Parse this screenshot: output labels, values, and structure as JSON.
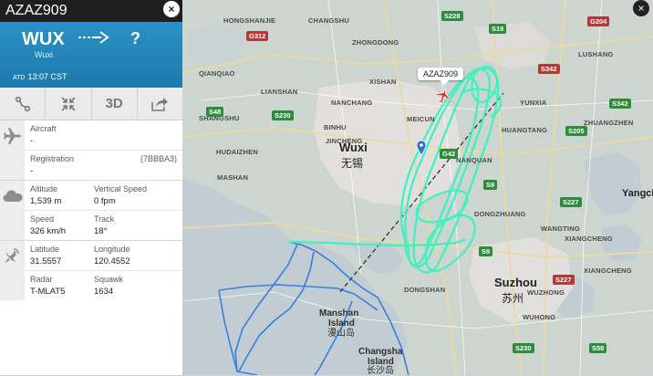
{
  "flight": {
    "callsign": "AZAZ909",
    "origin_code": "WUX",
    "origin_city": "Wuxi",
    "destination_code": "?",
    "atd_label": "ATD",
    "atd_time": "13:07 CST"
  },
  "toolbar": {
    "route_label": "route",
    "fullscreen_label": "fullscreen",
    "view3d_label": "3D",
    "share_label": "share"
  },
  "details": {
    "aircraft_label": "Aircraft",
    "aircraft_value": "-",
    "registration_label": "Registration",
    "registration_value": "-",
    "registration_hex": "(7BBBA3)",
    "altitude_label": "Altitude",
    "altitude_value": "1,539 m",
    "vertical_speed_label": "Vertical Speed",
    "vertical_speed_value": "0 fpm",
    "speed_label": "Speed",
    "speed_value": "326 km/h",
    "track_label": "Track",
    "track_value": "18°",
    "latitude_label": "Latitude",
    "latitude_value": "31.5557",
    "longitude_label": "Longitude",
    "longitude_value": "120.4552",
    "radar_label": "Radar",
    "radar_value": "T-MLAT5",
    "squawk_label": "Squawk",
    "squawk_value": "1634"
  },
  "map": {
    "plane_tag": "AZAZ909",
    "cities": {
      "wuxi": "Wuxi",
      "wuxi_cn": "无锡",
      "suzhou": "Suzhou",
      "suzhou_cn": "苏州",
      "manshan": "Manshan",
      "manshan_2": "Island",
      "manshan_cn": "漫山岛",
      "changsha": "Changsha",
      "changsha_2": "Island",
      "changsha_cn": "长沙岛",
      "yangch": "Yangch"
    },
    "districts": {
      "d1": "HONGSHANJIE",
      "d2": "CHANGSHU",
      "d3": "ZHONGDONG",
      "d4": "XISHAN",
      "d5": "NANCHANG",
      "d6": "LIANSHAN",
      "d7": "SHANGSHU",
      "d8": "YUNXIA",
      "d9": "LUSHANG",
      "d10": "MEICUN",
      "d11": "HUDAIZHEN",
      "d12": "JINCHENG",
      "d13": "BINHU",
      "d14": "NANQUAN",
      "d15": "WANGTING",
      "d16": "XIANGCHENG",
      "d17": "WUZHONG",
      "d18": "WUHONG",
      "d19": "DONGSHAN",
      "d20": "DONGZHUANG",
      "d21": "QIANQIAO",
      "d22": "MASHAN",
      "d23": "HUANGTANG",
      "d24": "ZHUANGZHEN",
      "d25": "XIANGCHENG"
    },
    "roads": {
      "g312": "G312",
      "s228": "S228",
      "s19": "S19",
      "s48": "S48",
      "s230": "S230",
      "s342": "S342",
      "g42": "G42",
      "s9": "S9",
      "s205": "S205",
      "s227": "S227",
      "s230b": "S230",
      "s58": "S58",
      "g204": "G204",
      "s227b": "S227",
      "s342b": "S342",
      "s9b": "S9"
    },
    "colors": {
      "water": "#c5cfd3",
      "land": "#cfd6d1",
      "city_area": "#e6e5e3",
      "track_current": "#3ff0c1",
      "track_prior": "#3a7fe0",
      "panel_header": "#2688bf"
    }
  },
  "close_label": "×"
}
